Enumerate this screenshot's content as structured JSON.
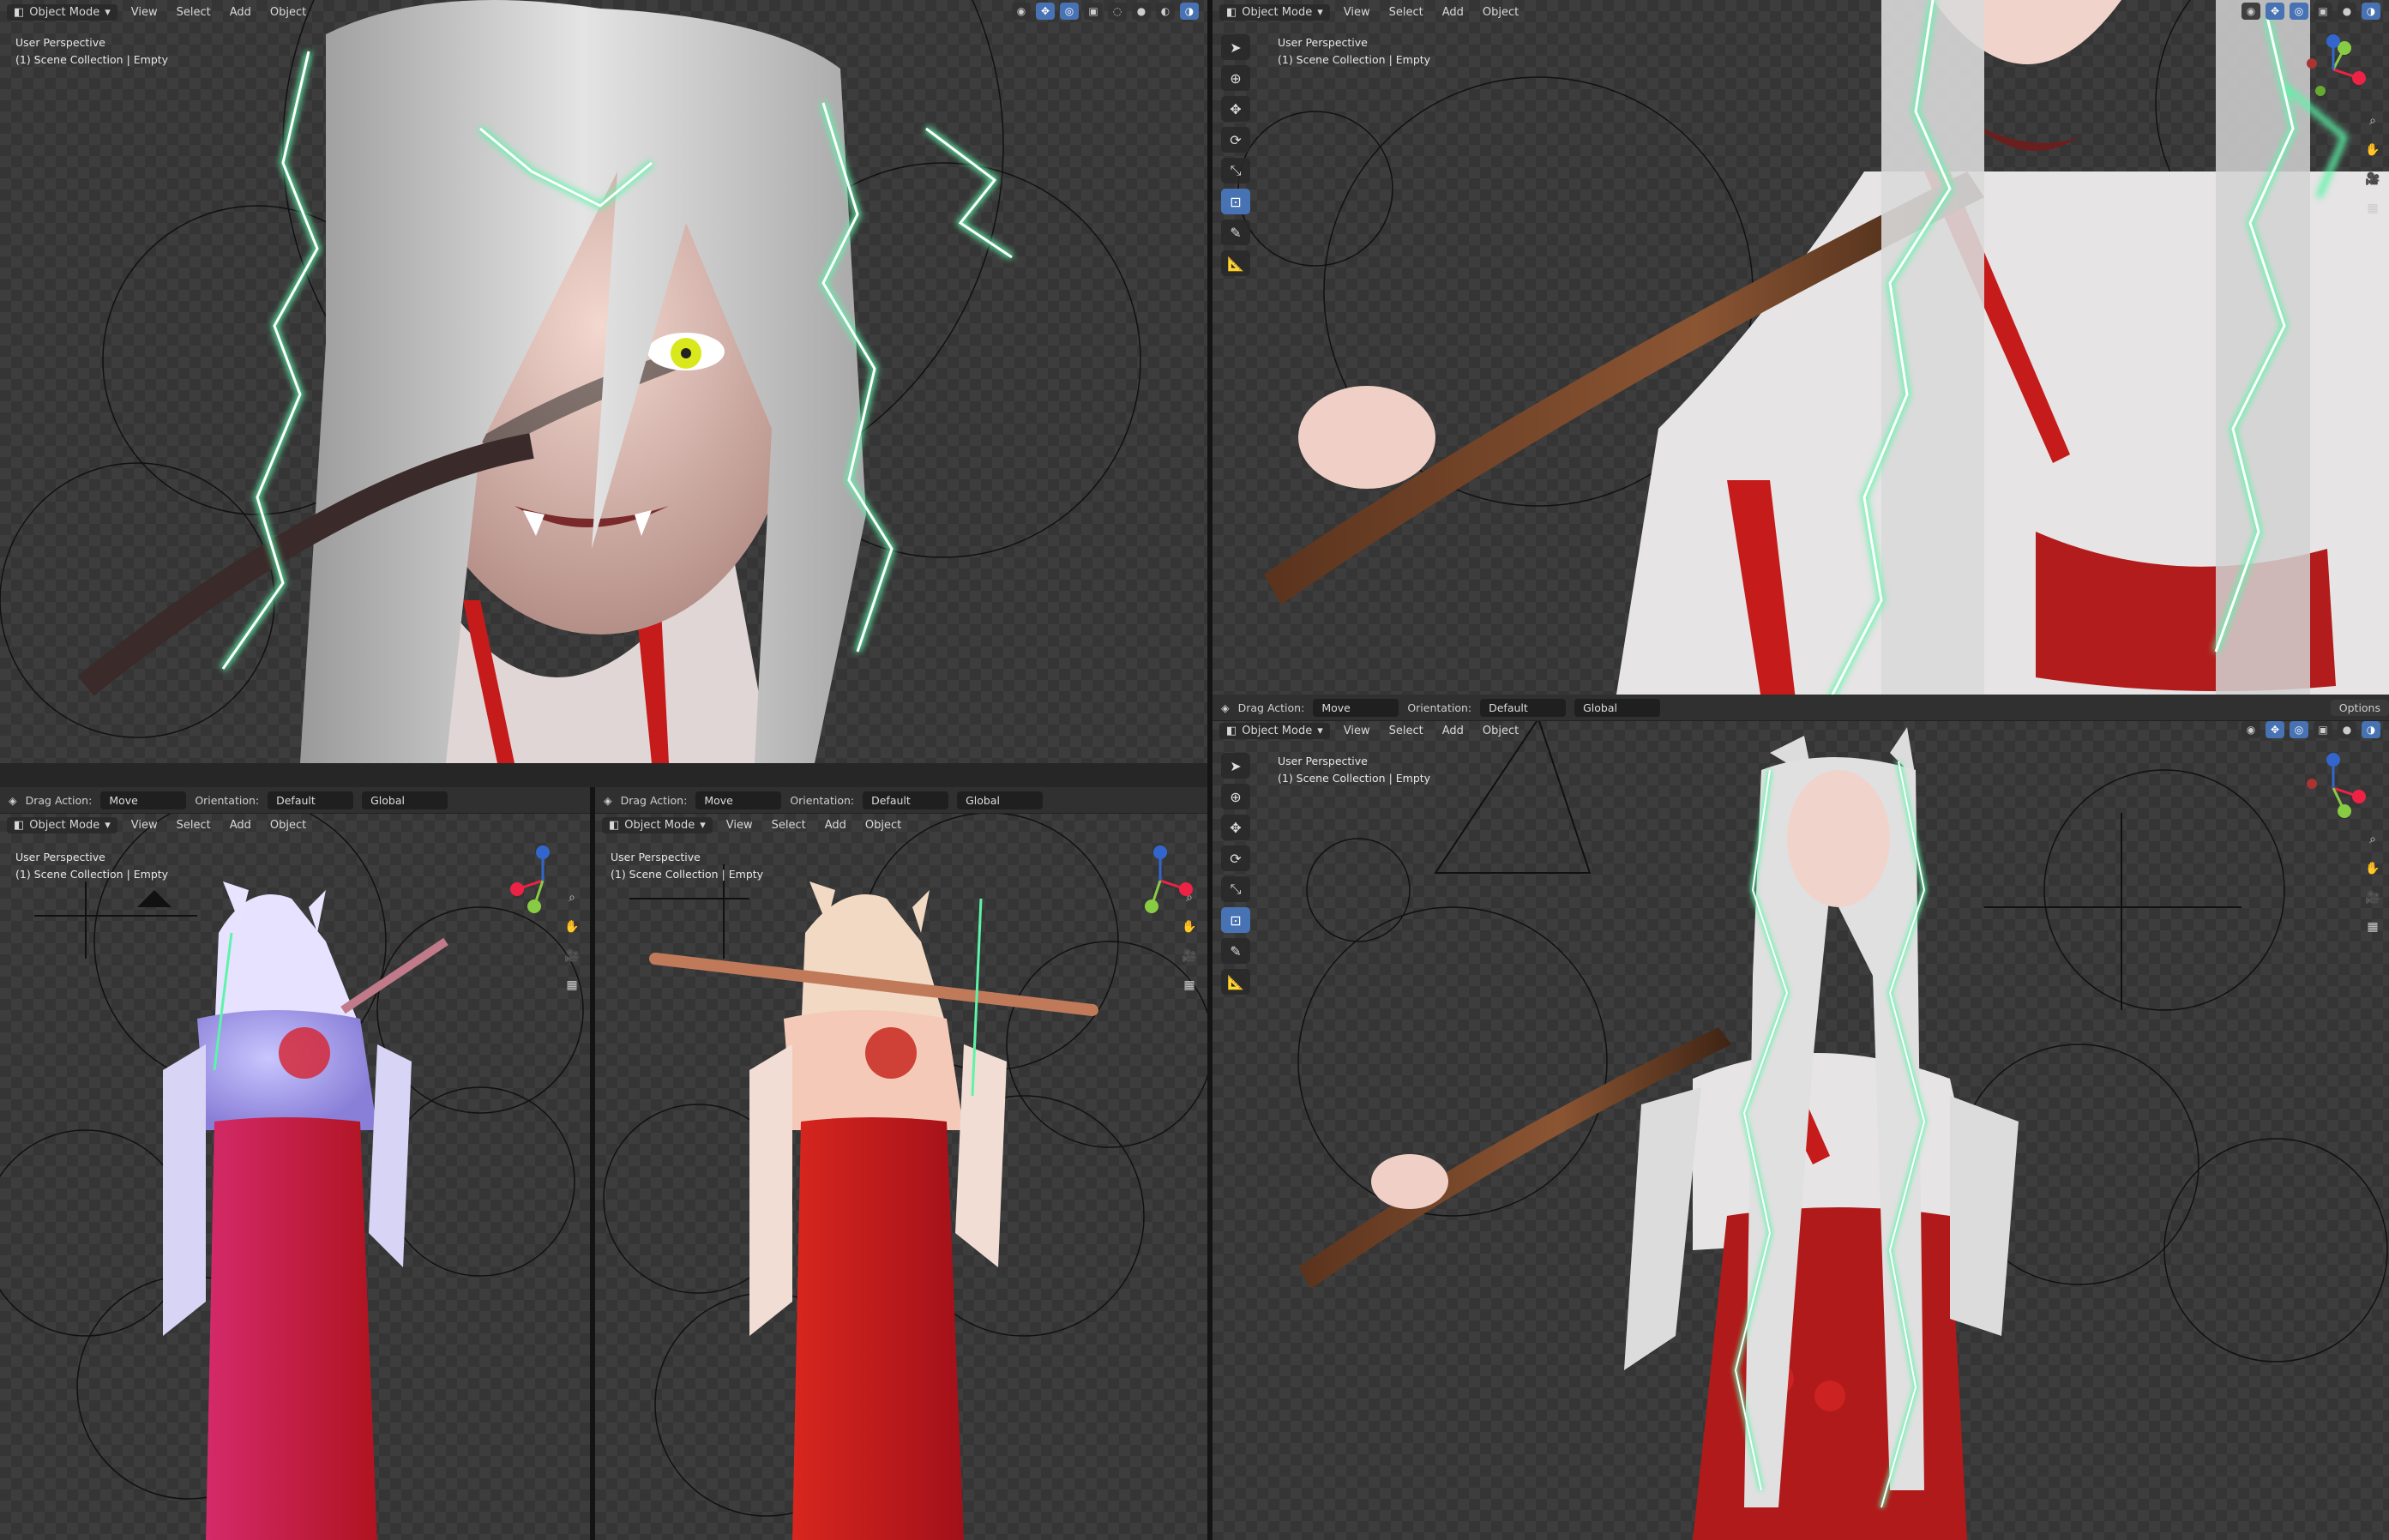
{
  "viewports": {
    "top_left": {
      "mode": "Object Mode",
      "menus": [
        "View",
        "Select",
        "Add",
        "Object"
      ],
      "overlay_line1": "User Perspective",
      "overlay_line2": "(1) Scene Collection | Empty"
    },
    "top_right": {
      "mode": "Object Mode",
      "menus": [
        "View",
        "Select",
        "Add",
        "Object"
      ],
      "overlay_line1": "User Perspective",
      "overlay_line2": "(1) Scene Collection | Empty"
    },
    "bottom_left": {
      "mode": "Object Mode",
      "menus": [
        "View",
        "Select",
        "Add",
        "Object"
      ],
      "overlay_line1": "User Perspective",
      "overlay_line2": "(1) Scene Collection | Empty",
      "tool_settings": {
        "drag_label": "Drag Action:",
        "drag_value": "Move",
        "orient_label": "Orientation:",
        "orient_value": "Default",
        "transform": "Global"
      }
    },
    "bottom_middle": {
      "mode": "Object Mode",
      "menus": [
        "View",
        "Select",
        "Add",
        "Object"
      ],
      "overlay_line1": "User Perspective",
      "overlay_line2": "(1) Scene Collection | Empty",
      "tool_settings": {
        "drag_label": "Drag Action:",
        "drag_value": "Move",
        "orient_label": "Orientation:",
        "orient_value": "Default",
        "transform": "Global"
      }
    },
    "bottom_right": {
      "mode": "Object Mode",
      "menus": [
        "View",
        "Select",
        "Add",
        "Object"
      ],
      "overlay_line1": "User Perspective",
      "overlay_line2": "(1) Scene Collection | Empty",
      "tool_settings": {
        "drag_label": "Drag Action:",
        "drag_value": "Move",
        "orient_label": "Orientation:",
        "orient_value": "Default",
        "transform": "Global",
        "options": "Options"
      }
    }
  },
  "gizmo_axes": {
    "x": "X",
    "y": "Y",
    "z": "Z"
  },
  "colors": {
    "accent": "#4772b3",
    "lightning": "#5cf5a8",
    "hakama_red": "#c0181c",
    "hair": "#d8d8d8",
    "eye_yellow": "#e8f020",
    "bat_wood": "#7a4a2c"
  },
  "icons": [
    "cursor-icon",
    "3d-cursor-icon",
    "move-icon",
    "rotate-icon",
    "scale-icon",
    "transform-icon",
    "annotate-icon",
    "measure-icon",
    "zoom-icon",
    "hand-icon",
    "camera-icon",
    "grid-icon"
  ]
}
